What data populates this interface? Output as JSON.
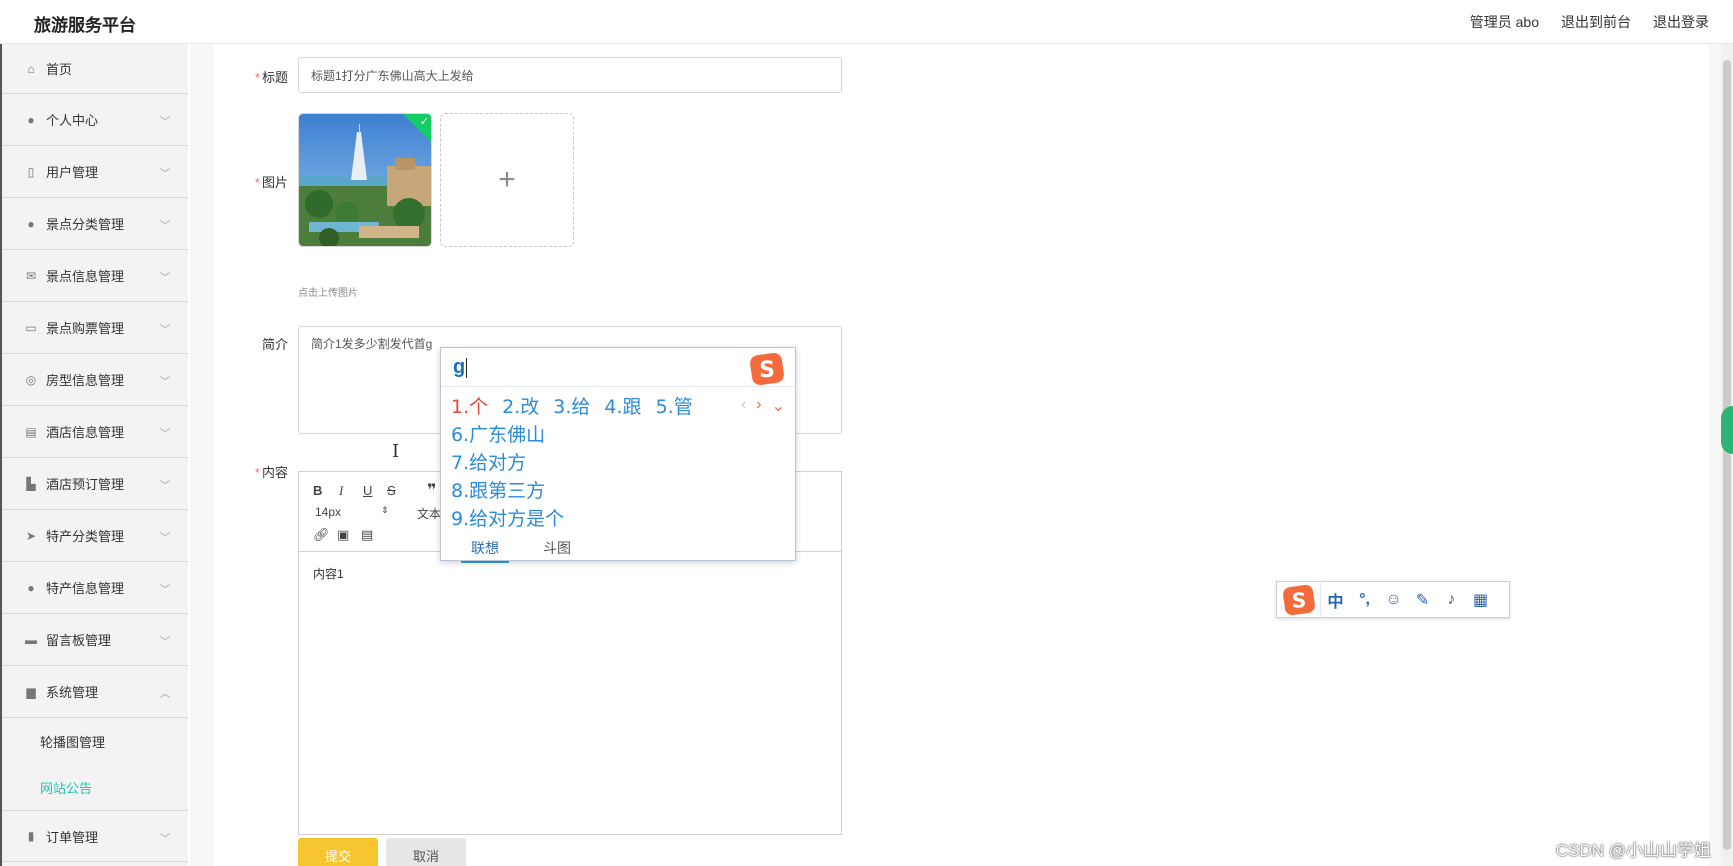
{
  "header": {
    "brand": "旅游服务平台",
    "admin_label": "管理员 abo",
    "to_frontend": "退出到前台",
    "logout": "退出登录"
  },
  "sidebar": {
    "items": [
      {
        "label": "首页",
        "icon": "home-icon"
      },
      {
        "label": "个人中心",
        "icon": "user-icon"
      },
      {
        "label": "用户管理",
        "icon": "users-icon"
      },
      {
        "label": "景点分类管理",
        "icon": "pin-icon"
      },
      {
        "label": "景点信息管理",
        "icon": "mail-icon"
      },
      {
        "label": "景点购票管理",
        "icon": "ticket-icon"
      },
      {
        "label": "房型信息管理",
        "icon": "compass-icon"
      },
      {
        "label": "酒店信息管理",
        "icon": "clipboard-icon"
      },
      {
        "label": "酒店预订管理",
        "icon": "thumb-icon"
      },
      {
        "label": "特产分类管理",
        "icon": "send-icon"
      },
      {
        "label": "特产信息管理",
        "icon": "user-icon"
      },
      {
        "label": "留言板管理",
        "icon": "chat-icon"
      },
      {
        "label": "系统管理",
        "icon": "briefcase-icon"
      }
    ],
    "sub_items": [
      {
        "label": "轮播图管理"
      },
      {
        "label": "网站公告"
      }
    ],
    "last_item": {
      "label": "订单管理",
      "icon": "chart-icon"
    }
  },
  "form": {
    "title_label": "标题",
    "title_value": "标题1打分广东佛山高大上发给",
    "image_label": "图片",
    "upload_hint": "点击上传图片",
    "intro_label": "简介",
    "intro_value": "简介1发多少割发代首g",
    "content_label": "内容",
    "required_mark": "*",
    "editor": {
      "font_size": "14px",
      "text_style": "文本",
      "content": "内容1"
    },
    "submit_label": "提交",
    "cancel_label": "取消"
  },
  "ime": {
    "input": "g",
    "candidates_row": [
      "1.个",
      "2.改",
      "3.给",
      "4.跟",
      "5.管"
    ],
    "candidates_more": [
      "6.广东佛山",
      "7.给对方",
      "8.跟第三方",
      "9.给对方是个"
    ],
    "tabs": [
      "联想",
      "斗图"
    ],
    "bar_lang": "中",
    "bar_punct": "°,"
  },
  "watermark": "CSDN @小山山学姐",
  "colors": {
    "accent": "#19c8b9",
    "submit": "#f7c52e",
    "required": "#f56c6c",
    "ime_blue": "#2c8bd9",
    "ime_red": "#e24a36"
  }
}
